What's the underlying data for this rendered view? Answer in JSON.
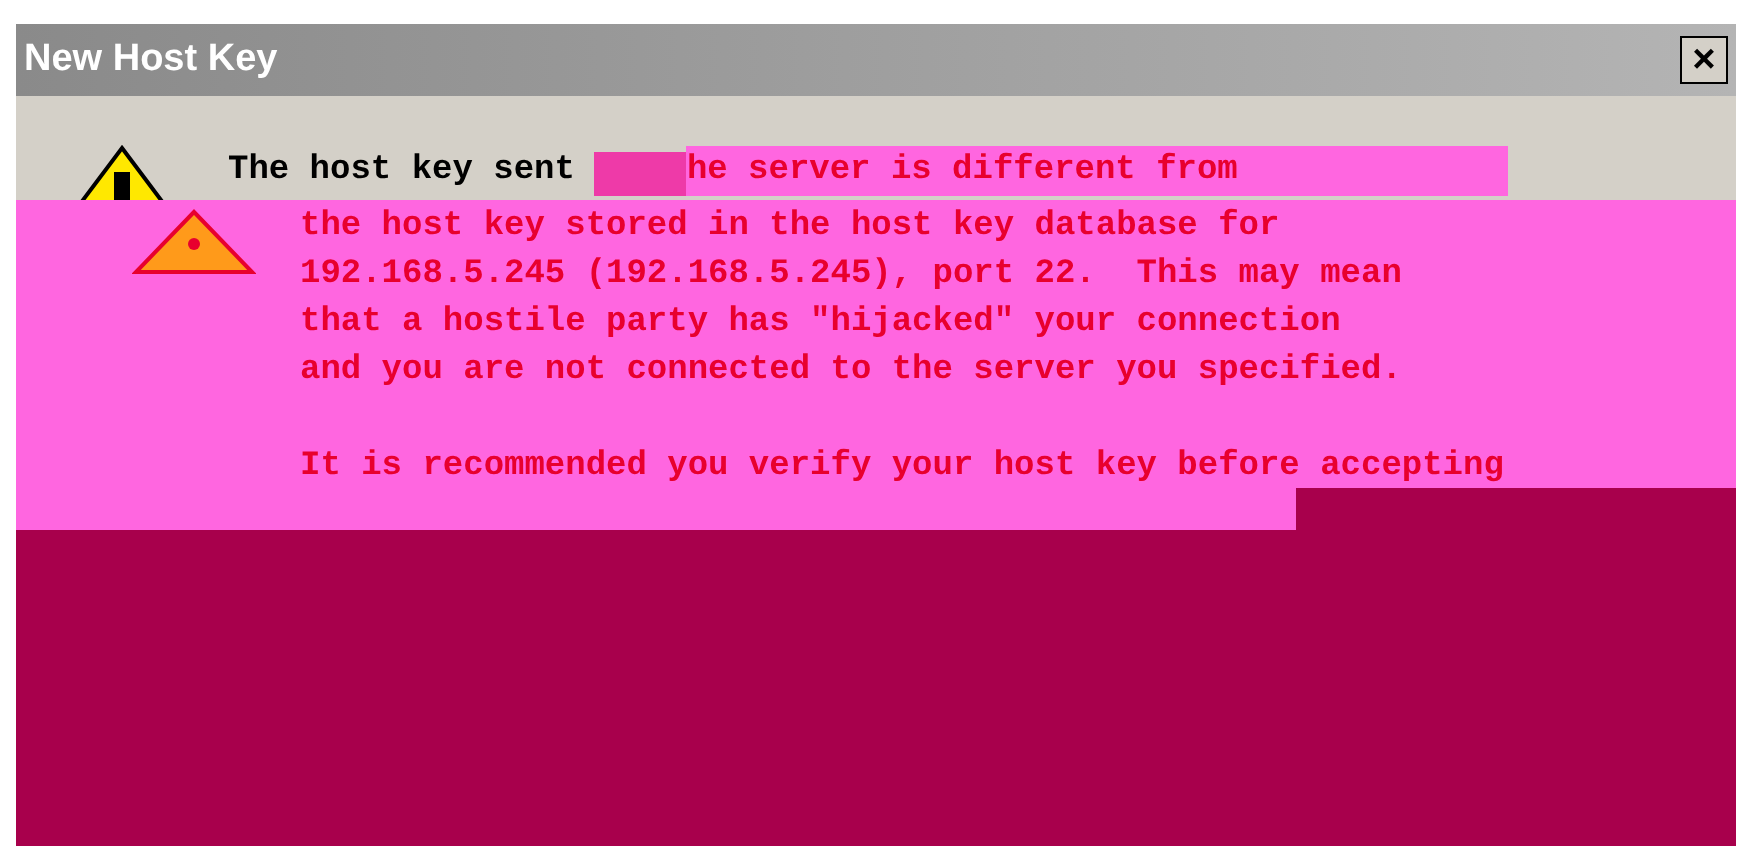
{
  "window": {
    "title": "New Host Key",
    "close": "×"
  },
  "message": {
    "first_line_start": "The host key sent",
    "first_line_end": "he server is different from",
    "lines": [
      "the host key stored in the host key database for",
      "192.168.5.245 (192.168.5.245), port 22.  This may mean",
      "that a hostile party has \"hijacked\" your connection",
      "and you are not connected to the server you specified."
    ],
    "recommendation": "It is recommended you verify your host key before accepting"
  }
}
